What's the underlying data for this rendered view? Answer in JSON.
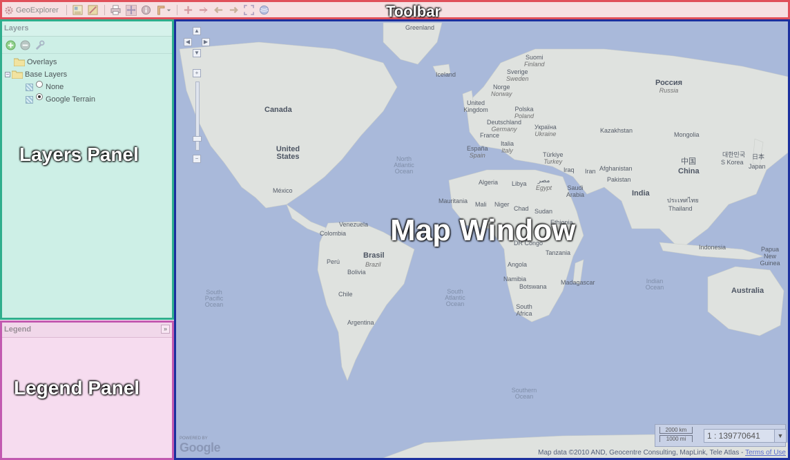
{
  "toolbar": {
    "app_name": "GeoExplorer",
    "annotation": "Toolbar",
    "buttons": [
      {
        "name": "layer-properties-icon"
      },
      {
        "name": "query-icon"
      },
      {
        "name": "print-icon"
      },
      {
        "name": "pan-icon"
      },
      {
        "name": "info-icon"
      },
      {
        "name": "measure-icon"
      },
      {
        "name": "zoom-in-icon"
      },
      {
        "name": "zoom-out-icon"
      },
      {
        "name": "back-icon"
      },
      {
        "name": "forward-icon"
      },
      {
        "name": "zoom-extent-icon"
      },
      {
        "name": "globe-icon"
      }
    ]
  },
  "layers_panel": {
    "title": "Layers",
    "annotation": "Layers Panel",
    "tree": {
      "overlays": "Overlays",
      "base_layers": "Base Layers",
      "base_items": [
        {
          "label": "None",
          "selected": false
        },
        {
          "label": "Google Terrain",
          "selected": true
        }
      ]
    }
  },
  "legend_panel": {
    "title": "Legend",
    "annotation": "Legend Panel"
  },
  "map": {
    "annotation": "Map Window",
    "scale": {
      "km": "2000 km",
      "mi": "1000 mi",
      "ratio": "1 : 139770641"
    },
    "attribution": "Map data ©2010 AND, Geocentre Consulting, MapLink, Tele Atlas -",
    "terms_link": "Terms of Use",
    "powered_by": "POWERED BY",
    "google": "Google",
    "labels": {
      "greenland": "Greenland",
      "iceland": "Iceland",
      "canada": "Canada",
      "united_states": "United States",
      "mexico": "México",
      "north_atlantic_ocean": "North Atlantic Ocean",
      "south_pacific_ocean": "South Pacific Ocean",
      "south_atlantic_ocean": "South Atlantic Ocean",
      "indian_ocean": "Indian Ocean",
      "southern_ocean": "Southern Ocean",
      "venezuela": "Venezuela",
      "colombia": "Colombia",
      "peru": "Perú",
      "bolivia": "Bolivia",
      "brasil": "Brasil",
      "brasil_alt": "Brazil",
      "chile": "Chile",
      "argentina": "Argentina",
      "suomi": "Suomi",
      "suomi_alt": "Finland",
      "sverige": "Sverige",
      "sverige_alt": "Sweden",
      "norge": "Norge",
      "norge_alt": "Norway",
      "united_kingdom": "United Kingdom",
      "polska": "Polska",
      "polska_alt": "Poland",
      "deutschland": "Deutschland",
      "deutschland_alt": "Germany",
      "france": "France",
      "espana": "España",
      "espana_alt": "Spain",
      "italia": "Italia",
      "italia_alt": "Italy",
      "ukraina": "Україна",
      "ukraina_alt": "Ukraine",
      "turkiye": "Türkiye",
      "turkiye_alt": "Turkey",
      "rossiya": "Россия",
      "rossiya_alt": "Russia",
      "kazakhstan": "Kazakhstan",
      "mongolia": "Mongolia",
      "china_cn": "中国",
      "china": "China",
      "korea_cn": "대한민국",
      "korea": "S Korea",
      "japan_cn": "日本",
      "japan": "Japan",
      "iraq": "Iraq",
      "iran": "Iran",
      "afghanistan": "Afghanistan",
      "pakistan": "Pakistan",
      "india": "India",
      "thailand_th": "ประเทศไทย",
      "thailand": "Thailand",
      "algeria": "Algeria",
      "libya": "Libya",
      "egypt_ar": "مصر",
      "egypt": "Egypt",
      "saudi_arabia": "Saudi Arabia",
      "mauritania": "Mauritania",
      "mali": "Mali",
      "niger": "Niger",
      "chad": "Chad",
      "sudan": "Sudan",
      "ethiopia": "Ethiopia",
      "dr_congo": "DR Congo",
      "tanzania": "Tanzania",
      "angola": "Angola",
      "namibia": "Namibia",
      "botswana": "Botswana",
      "south_africa": "South Africa",
      "madagascar": "Madagascar",
      "indonesia": "Indonesia",
      "papua": "Papua New Guinea",
      "australia": "Australia"
    }
  }
}
